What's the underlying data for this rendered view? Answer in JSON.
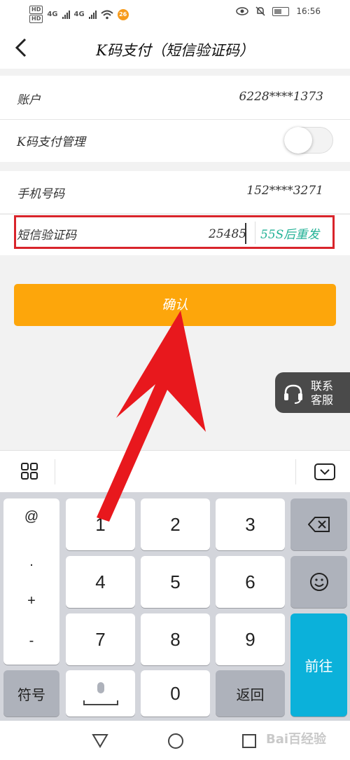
{
  "status_bar": {
    "hd1": "HD",
    "hd2": "HD",
    "net1": "4G",
    "net2": "4G",
    "badge": "26",
    "time": "16:56"
  },
  "header": {
    "back_icon": "back-arrow-icon",
    "title": "K码支付（短信验证码）"
  },
  "rows": {
    "account_label": "账户",
    "account_value": "6228****1373",
    "kpay_manage_label": "K码支付管理",
    "kpay_manage_on": false,
    "phone_label": "手机号码",
    "phone_value": "152****3271",
    "sms_label": "短信验证码",
    "sms_value": "25485",
    "resend_label": "55S后重发"
  },
  "confirm_label": "确认",
  "contact": {
    "label_line1": "联系",
    "label_line2": "客服",
    "icon": "headset-icon"
  },
  "keyboard": {
    "side_keys": [
      "@",
      ".",
      "+",
      "-"
    ],
    "digits": [
      "1",
      "2",
      "3",
      "4",
      "5",
      "6",
      "7",
      "8",
      "9",
      "0"
    ],
    "symbol_label": "符号",
    "return_label": "返回",
    "go_label": "前往"
  },
  "watermark": "Bai百经验",
  "colors": {
    "accent_orange": "#fda60b",
    "resend_green": "#23b296",
    "highlight_red": "#d9242b",
    "go_blue": "#0bb1da",
    "arrow_red": "#e8181d"
  }
}
